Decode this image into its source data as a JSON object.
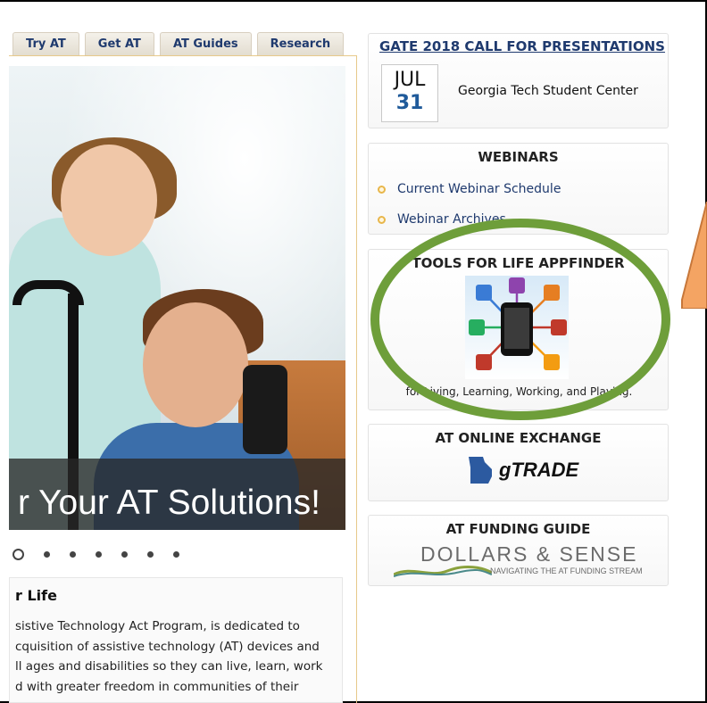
{
  "nav": {
    "tabs": [
      "Try AT",
      "Get AT",
      "AT Guides",
      "Research"
    ]
  },
  "hero": {
    "tagline": "r Your AT Solutions!"
  },
  "carousel": {
    "active_index": 0,
    "total": 7
  },
  "intro": {
    "heading": "r Life",
    "lines": [
      "sistive Technology Act Program, is dedicated to",
      "cquisition of assistive technology (AT) devices and",
      "ll ages and disabilities so they can live, learn, work",
      "d with greater freedom in communities of their"
    ]
  },
  "sidebar": {
    "gate": {
      "title": "GATE 2018 CALL FOR PRESENTATIONS",
      "month": "JUL",
      "day": "31",
      "location": "Georgia Tech Student Center"
    },
    "webinars": {
      "title": "WEBINARS",
      "items": [
        "Current Webinar Schedule",
        "Webinar Archives"
      ]
    },
    "appfinder": {
      "title": "TOOLS FOR LIFE APPFINDER",
      "caption": "for Living, Learning, Working, and Playing."
    },
    "exchange": {
      "title": "AT ONLINE EXCHANGE",
      "logo_text": "gTRADE"
    },
    "funding": {
      "title": "AT FUNDING GUIDE",
      "logo_title": "DOLLARS & SENSE",
      "logo_subtitle": "NAVIGATING THE AT FUNDING STREAM"
    }
  },
  "colors": {
    "nav_text": "#1f3a6e",
    "accent_border": "#e7c98a",
    "highlight_ellipse": "#6e9e3a",
    "arrow_fill": "#f4a463",
    "arrow_stroke": "#c7773a"
  }
}
